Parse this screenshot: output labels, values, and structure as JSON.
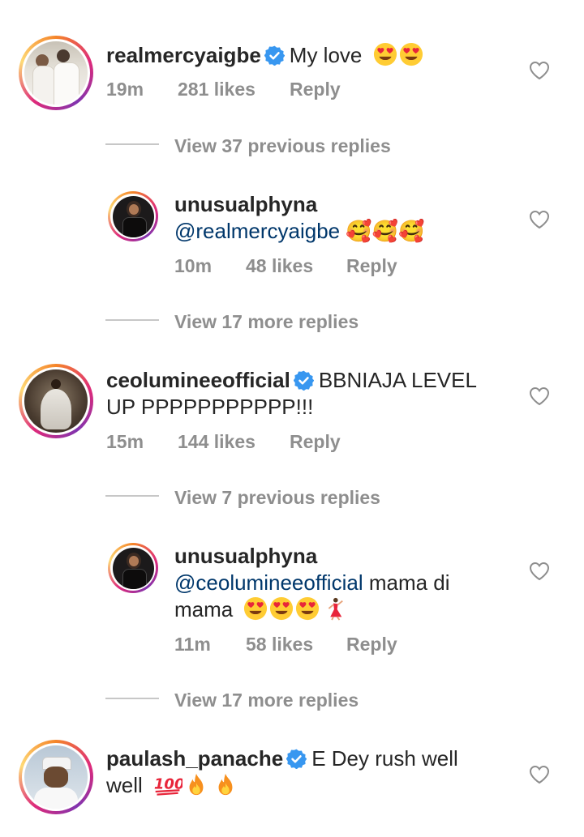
{
  "comments": [
    {
      "username": "realmercyaigbe",
      "verified": true,
      "text": "My love",
      "emoji_count": 2,
      "time": "19m",
      "likes": "281 likes",
      "reply": "Reply",
      "view_more": "View 37 previous replies"
    },
    {
      "username": "unusualphyna",
      "verified": false,
      "mention": "@realmercyaigbe",
      "text": "🥰🥰🥰",
      "time": "10m",
      "likes": "48 likes",
      "reply": "Reply",
      "view_more": "View 17 more replies"
    },
    {
      "username": "ceolumineeofficial",
      "verified": true,
      "text_line1": "BBNIAJA LEVEL",
      "text_line2": "UP PPPPPPPPPPP!!!",
      "time": "15m",
      "likes": "144 likes",
      "reply": "Reply",
      "view_more": "View 7 previous replies"
    },
    {
      "username": "unusualphyna",
      "verified": false,
      "mention": "@ceolumineeofficial",
      "text_line1": "mama di",
      "text_line2": "mama",
      "time": "11m",
      "likes": "58 likes",
      "reply": "Reply",
      "view_more": "View 17 more replies"
    },
    {
      "username": "paulash_panache",
      "verified": true,
      "text_line1": "E Dey rush well",
      "text_line2": "well",
      "time": "",
      "likes": "",
      "reply": ""
    }
  ],
  "colors": {
    "text": "#262626",
    "meta": "#8e8e8e",
    "mention": "#00376b",
    "verified": "#3897f0"
  },
  "icons": [
    "heart-outline-icon",
    "verified-badge-icon",
    "heart-eyes-emoji",
    "fire-emoji",
    "hundred-emoji",
    "dancer-emoji"
  ]
}
